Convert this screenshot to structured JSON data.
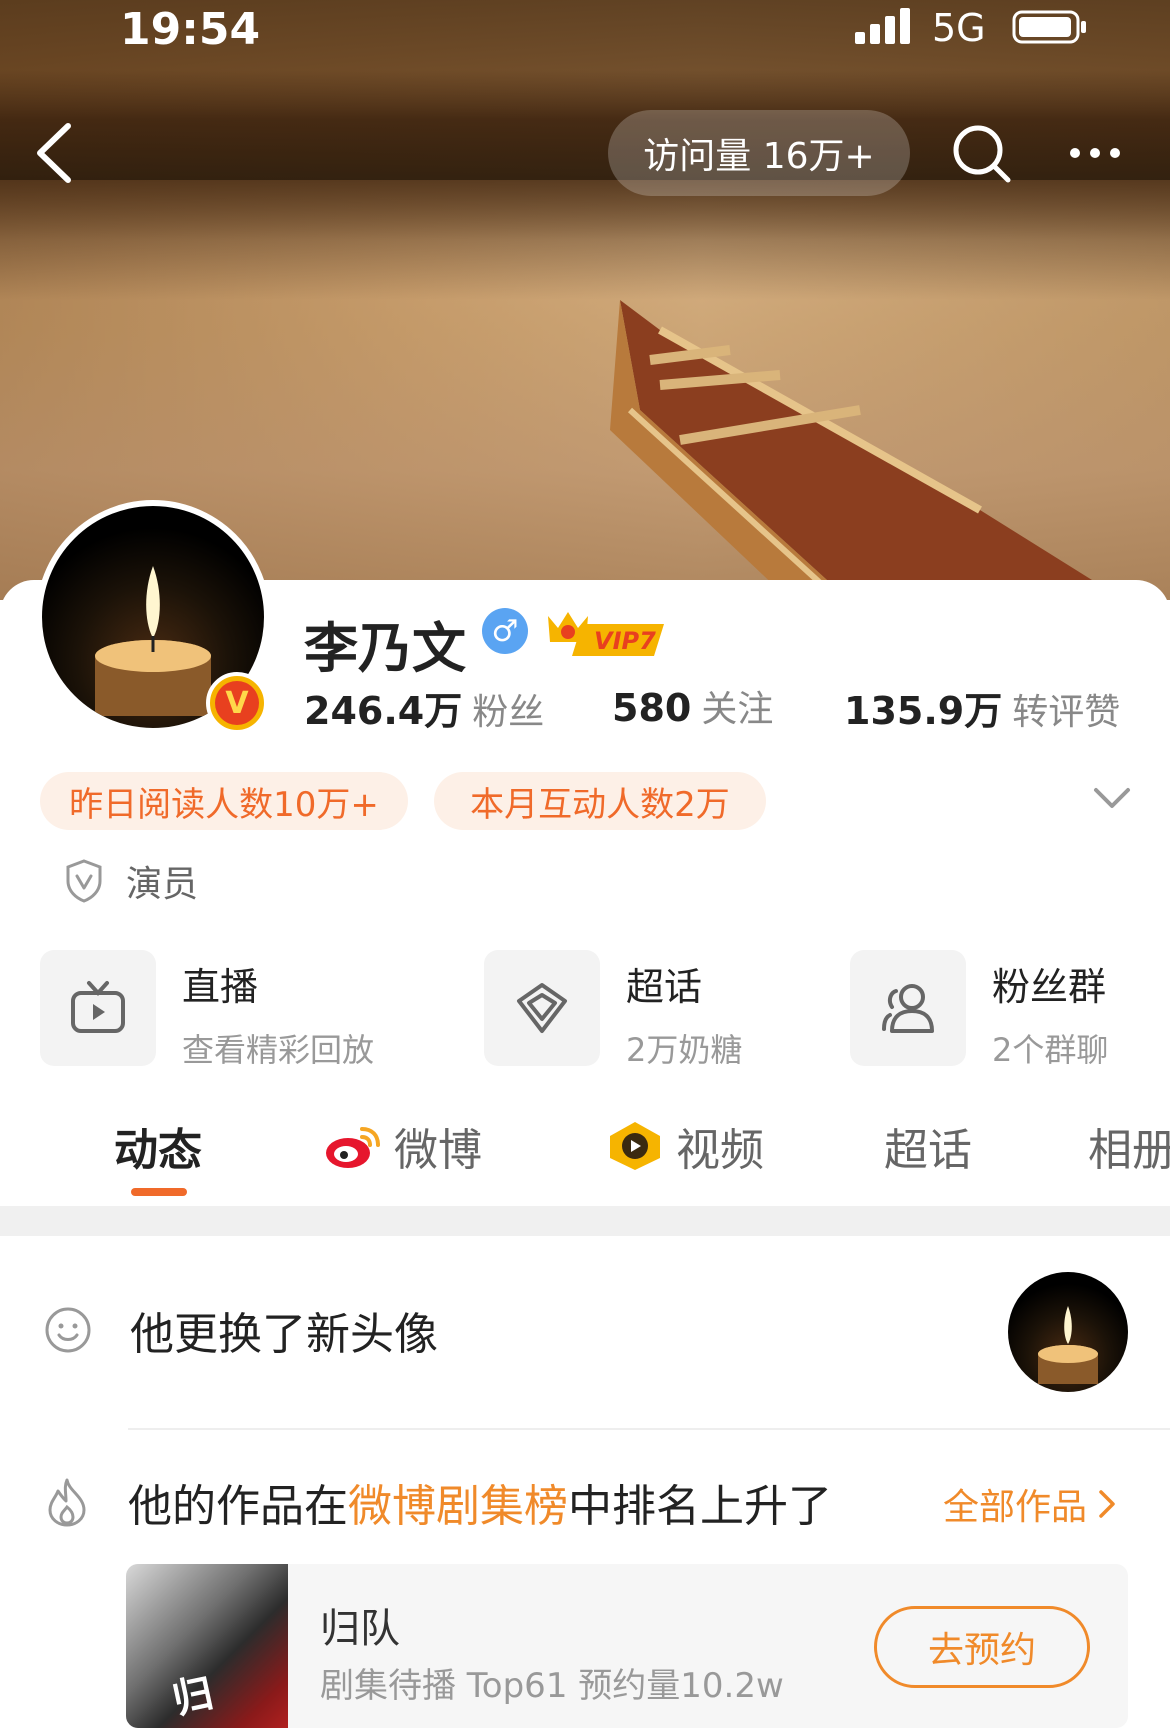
{
  "status_bar": {
    "time": "19:54",
    "network": "5G"
  },
  "header": {
    "visit_count": "访问量 16万+"
  },
  "profile": {
    "name": "李乃文",
    "gender_symbol": "♂",
    "vip_label": "VIP7",
    "verified_letter": "V",
    "stats": [
      {
        "num": "246.4万",
        "label": "粉丝"
      },
      {
        "num": "580",
        "label": "关注"
      },
      {
        "num": "135.9万",
        "label": "转评赞"
      }
    ],
    "chips": [
      "昨日阅读人数10万+",
      "本月互动人数2万"
    ],
    "role": "演员"
  },
  "features": [
    {
      "title": "直播",
      "subtitle": "查看精彩回放",
      "icon": "tv-icon"
    },
    {
      "title": "超话",
      "subtitle": "2万奶糖",
      "icon": "diamond-icon"
    },
    {
      "title": "粉丝群",
      "subtitle": "2个群聊",
      "icon": "group-icon"
    }
  ],
  "tabs": [
    {
      "label": "动态",
      "active": true
    },
    {
      "label": "微博",
      "icon": "weibo-icon"
    },
    {
      "label": "视频",
      "icon": "video-icon"
    },
    {
      "label": "超话"
    },
    {
      "label": "相册"
    }
  ],
  "feed": {
    "avatar_update": "他更换了新头像",
    "rank_prefix": "他的作品在",
    "rank_highlight": "微博剧集榜",
    "rank_suffix": "中排名上升了",
    "all_works": "全部作品",
    "work": {
      "title": "归队",
      "subtitle": "剧集待播 Top61 预约量10.2w",
      "button": "去预约",
      "poster_glyph": "归"
    }
  },
  "colors": {
    "accent": "#f06a2a",
    "highlight": "#f08a2a",
    "chip_bg": "#fdf0e7"
  }
}
